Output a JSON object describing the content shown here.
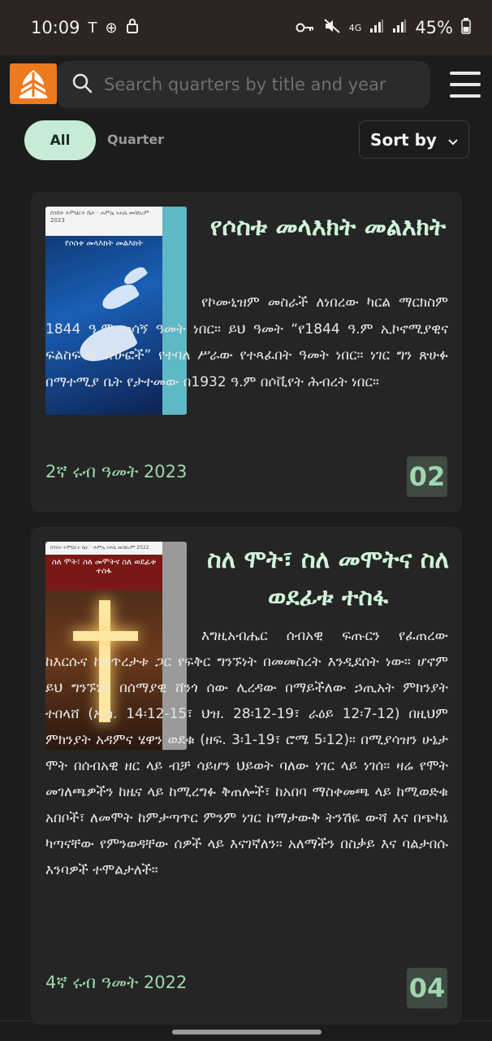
{
  "status_bar": {
    "time": "10:09",
    "left_icons": [
      "T",
      "⊕",
      "🔒"
    ],
    "right_icons": [
      "key-icon",
      "mute-icon",
      "4G",
      "signal-icon",
      "signal-icon"
    ],
    "battery": "45%"
  },
  "header": {
    "search_placeholder": "Search quarters by title and year"
  },
  "filters": {
    "all_label": "All",
    "quarter_label": "Quarter",
    "sort_label": "Sort by"
  },
  "cards": [
    {
      "cover_top": "ሰንበት ትምህርት ቤት · ሐምሌ ነሐሴ መስከረም 2023",
      "cover_title": "የሶስቱ መላእክት መልእክት",
      "title": "የሶስቱ መላእክት መልእክት",
      "description": "የኮሙኒዝም መስራች ለነበረው ካርል ማርክስም 1844 ዓ.ም ወሳኝ ዓመት ነበር። ይህ ዓመት “የ1844 ዓ.ም ኢኮኖሚያዊና ፍልስፍናዊ ጽሁፎች” የተባለ ሥራው የተጻፈበት ዓመት ነበር። ነገር ግን ጽሁፉ በማተሚያ ቤት የታተመው በ1932 ዓ.ም በሶቪየት ሕብረት ነበር።",
      "date": "2ኛ ሩብ ዓመት 2023",
      "quarter_number": "02"
    },
    {
      "cover_top": "ሰንበት ትምህርት ቤት · ሐምሌ ነሐሴ መስከረም 2022",
      "cover_title": "ስለ ሞት፣ ስለ መሞትና ስለ ወደፊቱ ተስፋ",
      "title": "ስለ ሞት፣ ስለ መሞትና ስለ ወደፊቱ ተስፋ",
      "description": "እግዚአብሔር ሰብአዊ ፍጡርን የፈጠረው ከእርሱና ከፍጥረታቱ ጋር የፍቅር ግንኙነት በመመስረት እንዲደሰት ነው። ሆኖም ይህ ግንኙነት በሰማያዊ ሸንጎ ሰው ሊረዳው በማይችለው ኃጢአት ምክንያት ተበላሸ (ኢሳ. 14፡12-15፣ ህዝ. 28፡12-19፣ ራዕይ 12፡7-12) በዚህም ምክንያት አዳምና ሄዋን ወደቁ (ዘፍ. 3፡1-19፣ ሮሜ 5፡12)። በሚያሳዝን ሁኔታ ሞት በሰብአዊ ዘር ላይ ብቻ ሳይሆን ህይወት ባለው ነገር ላይ ነገሰ። ዛሬ የሞት መገለጫዎችን ከዜና ላይ ከሚረግፉ ቅጠሎች፣ ከአበባ ማስቀመጫ ላይ ከሚወድቁ አበቦች፣ ለመሞት ከምታጣጥር ምንም ነገር ከማታውቅ ትንሽዬ ውሻ እና በጭካኔ ካጣናቸው የምንወዳቸው ሰዎች ላይ እናገኛለን። አለማችን በስቃይ እና ባልታበሱ እንባዎች ተሞልታለች።",
      "date": "4ኛ ሩብ ዓመት 2022",
      "quarter_number": "04"
    }
  ],
  "colors": {
    "background": "#1c1c1c",
    "card": "#252525",
    "accent_green": "#cff3d9",
    "chip_active": "#c7ecd5",
    "logo_orange": "#ee7a1f"
  }
}
